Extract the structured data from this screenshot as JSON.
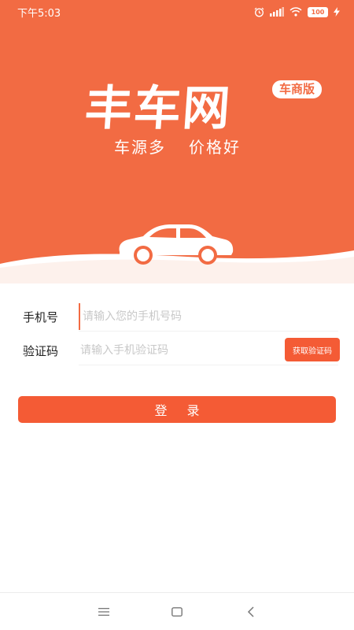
{
  "status_bar": {
    "time": "下午5:03",
    "battery": "100",
    "icons": [
      "alarm-icon",
      "signal-icon",
      "wifi-icon",
      "battery-icon",
      "charging-icon"
    ]
  },
  "hero": {
    "logo": "丰车网",
    "badge": "车商版",
    "slogan_left": "车源多",
    "slogan_right": "价格好"
  },
  "form": {
    "phone_label": "手机号",
    "phone_placeholder": "请输入您的手机号码",
    "code_label": "验证码",
    "code_placeholder": "请输入手机验证码",
    "get_code_button": "获取验证码"
  },
  "login_button": "登 录",
  "nav_bar": {
    "icons": [
      "menu-icon",
      "home-icon",
      "back-icon"
    ]
  },
  "colors": {
    "brand": "#f26b43",
    "button": "#f45b35",
    "text": "#222222",
    "placeholder": "#c8c8c8"
  }
}
